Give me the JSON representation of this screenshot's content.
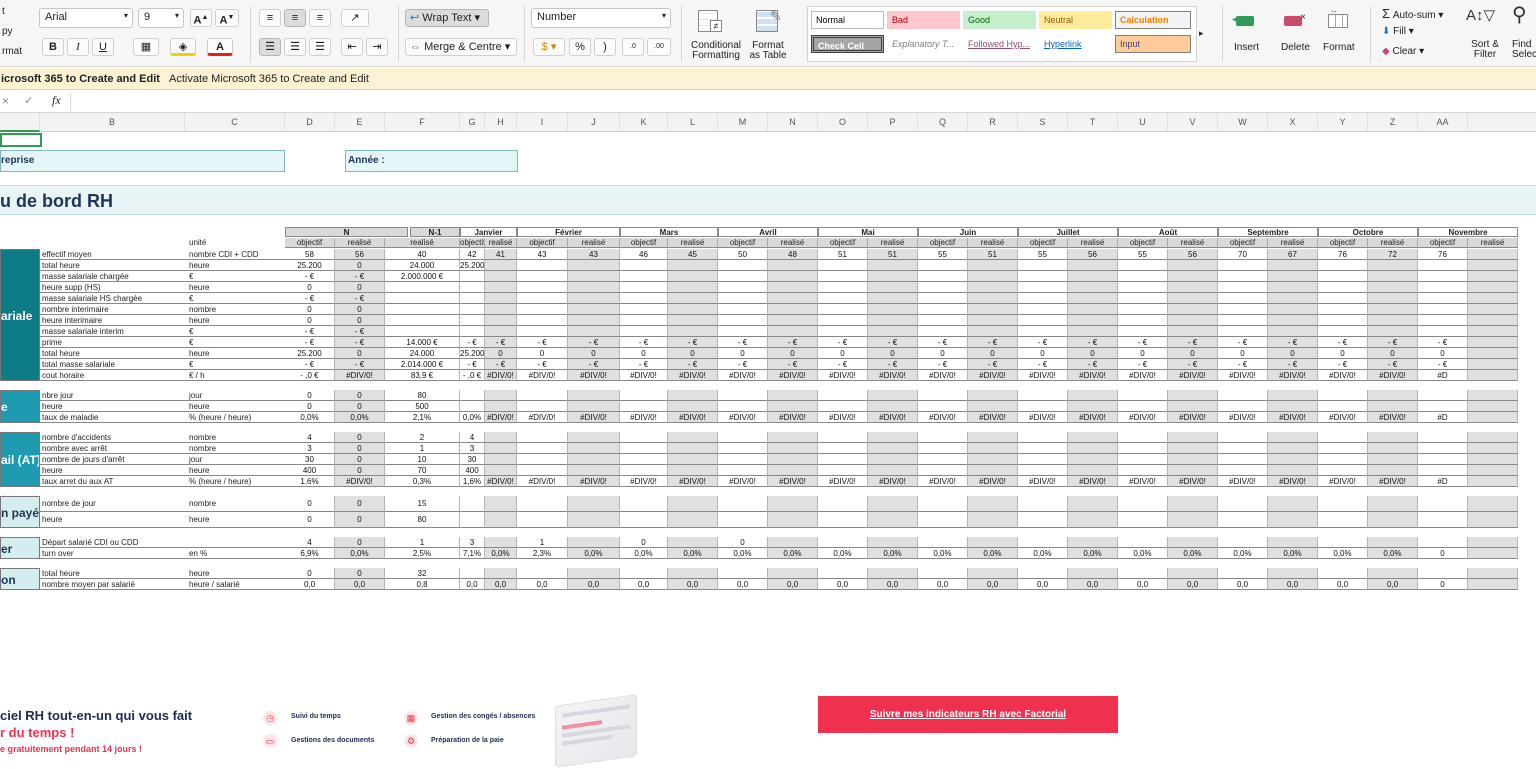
{
  "ribbon": {
    "clip_left": [
      "t",
      "py",
      "rmat"
    ],
    "font_name": "Arial",
    "font_size": "9",
    "font_grow": "A",
    "font_shrink": "A",
    "bold": "B",
    "italic": "I",
    "underline": "U",
    "wrap_text": "Wrap Text",
    "merge": "Merge & Centre",
    "number_format": "Number",
    "percent": "%",
    "comma": ")",
    "inc_dec": ".0",
    "dec_dec": ".00",
    "cond_format_l1": "Conditional",
    "cond_format_l2": "Formatting",
    "format_table_l1": "Format",
    "format_table_l2": "as Table",
    "styles": [
      "Normal",
      "Bad",
      "Good",
      "Neutral",
      "Calculation",
      "Check Cell",
      "Explanatory T...",
      "Followed Hyp...",
      "Hyperlink",
      "Input"
    ],
    "insert": "Insert",
    "delete": "Delete",
    "format": "Format",
    "autosum": "Auto-sum",
    "fill": "Fill",
    "clear": "Clear",
    "sort_l1": "Sort &",
    "sort_l2": "Filter",
    "find_l1": "Find",
    "find_l2": "Selec"
  },
  "message_bar": {
    "text": "icrosoft 365 to Create and Edit",
    "link": "Activate Microsoft 365 to Create and Edit"
  },
  "formula_bar": {
    "fx": "fx"
  },
  "columns": [
    "B",
    "C",
    "D",
    "E",
    "F",
    "G",
    "H",
    "I",
    "J",
    "K",
    "L",
    "M",
    "N",
    "O",
    "P",
    "Q",
    "R",
    "S",
    "T",
    "U",
    "V",
    "W",
    "X",
    "Y",
    "Z",
    "AA"
  ],
  "sheet": {
    "company_label": "reprise",
    "year_label": "Année :",
    "title": "u de bord RH",
    "header_n": "N",
    "header_n1": "N-1",
    "months": [
      "Janvier",
      "Février",
      "Mars",
      "Avril",
      "Mai",
      "Juin",
      "Juillet",
      "Août",
      "Septembre",
      "Octobre",
      "Novembre"
    ],
    "unit_header": "unité",
    "objectif": "objectif",
    "realise": "realisé",
    "sections": [
      "ariale",
      "e",
      "ail (AT)",
      "n payée",
      "er",
      "on"
    ],
    "rows": [
      [
        "effectif moyen",
        "nombre CDI + CDD",
        "58",
        "56",
        "40",
        "42",
        "41",
        "43",
        "43",
        "46",
        "45",
        "50",
        "48",
        "51",
        "51",
        "55",
        "51",
        "55",
        "56",
        "55",
        "56",
        "70",
        "67",
        "76",
        "72",
        "76"
      ],
      [
        "total heure",
        "heure",
        "25.200",
        "0",
        "24.000",
        "25.200"
      ],
      [
        "masse salariale chargée",
        "€",
        "-  €",
        "-  €",
        "2.000.000 €"
      ],
      [
        "heure supp (HS)",
        "heure",
        "0",
        "0"
      ],
      [
        "masse salariale HS chargée",
        "€",
        "-  €",
        "-  €"
      ],
      [
        "nombre interimaire",
        "nombre",
        "0",
        "0"
      ],
      [
        "heure interimaire",
        "heure",
        "0",
        "0"
      ],
      [
        "masse salariale interim",
        "€",
        "-  €",
        "-  €"
      ],
      [
        "prime",
        "€",
        "-  €",
        "-  €",
        "14.000 €",
        "-  €",
        "-  €",
        "-  €",
        "-  €",
        "-  €",
        "-  €",
        "-  €",
        "-  €",
        "-  €",
        "-  €",
        "-  €",
        "-  €",
        "-  €",
        "-  €",
        "-  €",
        "-  €",
        "-  €",
        "-  €",
        "-  €",
        "-  €",
        "-  €"
      ],
      [
        "total heure",
        "heure",
        "25.200",
        "0",
        "24.000",
        "25.200",
        "0",
        "0",
        "0",
        "0",
        "0",
        "0",
        "0",
        "0",
        "0",
        "0",
        "0",
        "0",
        "0",
        "0",
        "0",
        "0",
        "0",
        "0",
        "0",
        "0"
      ],
      [
        "total masse salariale",
        "€",
        "-  €",
        "-  €",
        "2.014.000 €",
        "-  €",
        "-  €",
        "-  €",
        "-  €",
        "-  €",
        "-  €",
        "-  €",
        "-  €",
        "-  €",
        "-  €",
        "-  €",
        "-  €",
        "-  €",
        "-  €",
        "-  €",
        "-  €",
        "-  €",
        "-  €",
        "-  €",
        "-  €",
        "-  €"
      ],
      [
        "cout horaire",
        "€ / h",
        "- ,0 €",
        "#DIV/0!",
        "83,9 €",
        "- ,0 €",
        "#DIV/0!",
        "#DIV/0!",
        "#DIV/0!",
        "#DIV/0!",
        "#DIV/0!",
        "#DIV/0!",
        "#DIV/0!",
        "#DIV/0!",
        "#DIV/0!",
        "#DIV/0!",
        "#DIV/0!",
        "#DIV/0!",
        "#DIV/0!",
        "#DIV/0!",
        "#DIV/0!",
        "#DIV/0!",
        "#DIV/0!",
        "#DIV/0!",
        "#DIV/0!",
        "#D"
      ],
      [
        "nbre jour",
        "jour",
        "0",
        "0",
        "80"
      ],
      [
        "heure",
        "heure",
        "0",
        "0",
        "500"
      ],
      [
        "taux de maladie",
        "% (heure / heure)",
        "0,0%",
        "0,0%",
        "2,1%",
        "0,0%",
        "#DIV/0!",
        "#DIV/0!",
        "#DIV/0!",
        "#DIV/0!",
        "#DIV/0!",
        "#DIV/0!",
        "#DIV/0!",
        "#DIV/0!",
        "#DIV/0!",
        "#DIV/0!",
        "#DIV/0!",
        "#DIV/0!",
        "#DIV/0!",
        "#DIV/0!",
        "#DIV/0!",
        "#DIV/0!",
        "#DIV/0!",
        "#DIV/0!",
        "#DIV/0!",
        "#D"
      ],
      [
        "nombre d'accidents",
        "nombre",
        "4",
        "0",
        "2",
        "4"
      ],
      [
        "nombre avec arrêt",
        "nombre",
        "3",
        "0",
        "1",
        "3"
      ],
      [
        "nombre de jours d'arrêt",
        "jour",
        "30",
        "0",
        "10",
        "30"
      ],
      [
        "heure",
        "heure",
        "400",
        "0",
        "70",
        "400"
      ],
      [
        "taux arret du aux AT",
        "% (heure / heure)",
        "1,6%",
        "#DIV/0!",
        "0,3%",
        "1,6%",
        "#DIV/0!",
        "#DIV/0!",
        "#DIV/0!",
        "#DIV/0!",
        "#DIV/0!",
        "#DIV/0!",
        "#DIV/0!",
        "#DIV/0!",
        "#DIV/0!",
        "#DIV/0!",
        "#DIV/0!",
        "#DIV/0!",
        "#DIV/0!",
        "#DIV/0!",
        "#DIV/0!",
        "#DIV/0!",
        "#DIV/0!",
        "#DIV/0!",
        "#DIV/0!",
        "#D"
      ],
      [
        "nombre de jour",
        "nombre",
        "0",
        "0",
        "15"
      ],
      [
        "heure",
        "heure",
        "0",
        "0",
        "80"
      ],
      [
        "Départ salarié CDI ou CDD",
        "",
        "4",
        "0",
        "1",
        "3",
        "",
        "1",
        "",
        "0",
        "",
        "0"
      ],
      [
        "turn over",
        "en %",
        "6,9%",
        "0,0%",
        "2,5%",
        "7,1%",
        "0,0%",
        "2,3%",
        "0,0%",
        "0,0%",
        "0,0%",
        "0,0%",
        "0,0%",
        "0,0%",
        "0,0%",
        "0,0%",
        "0,0%",
        "0,0%",
        "0,0%",
        "0,0%",
        "0,0%",
        "0,0%",
        "0,0%",
        "0,0%",
        "0,0%",
        "0"
      ],
      [
        "total heure",
        "heure",
        "0",
        "0",
        "32"
      ],
      [
        "nombre moyen par salarié",
        "heure / salarié",
        "0,0",
        "0,0",
        "0,8",
        "0,0",
        "0,0",
        "0,0",
        "0,0",
        "0,0",
        "0,0",
        "0,0",
        "0,0",
        "0,0",
        "0,0",
        "0,0",
        "0,0",
        "0,0",
        "0,0",
        "0,0",
        "0,0",
        "0,0",
        "0,0",
        "0,0",
        "0,0",
        "0"
      ]
    ]
  },
  "promo": {
    "line1": "ciel RH tout-en-un qui vous fait",
    "line2": "r du temps !",
    "line3": "e gratuitement pendant 14 jours !",
    "feature1": "Suivi du temps",
    "feature2": "Gestions des documents",
    "feature3": "Gestion des congés / absences",
    "feature4": "Préparation de la paie",
    "cta": "Suivre mes indicateurs RH avec Factorial"
  },
  "colors": {
    "teal": "#0e7c86",
    "cta": "#f0304f",
    "banner": "#fdf3d4"
  }
}
